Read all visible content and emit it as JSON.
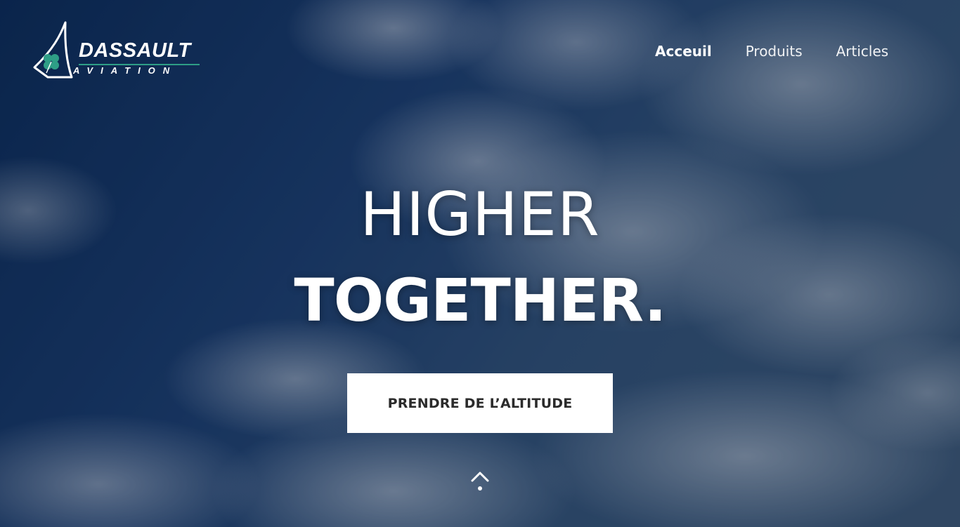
{
  "brand": {
    "name": "DASSAULT",
    "subtitle": "AVIATION",
    "accent_color": "#2e9e86",
    "logo_icon": "four-leaf-clover-icon"
  },
  "nav": {
    "items": [
      {
        "label": "Acceuil",
        "active": true
      },
      {
        "label": "Produits",
        "active": false
      },
      {
        "label": "Articles",
        "active": false
      }
    ]
  },
  "hero": {
    "line1": "HIGHER",
    "line2": "TOGETHER.",
    "cta_label": "PRENDRE DE L’ALTITUDE",
    "scroll_icon": "chevron-up-icon"
  }
}
